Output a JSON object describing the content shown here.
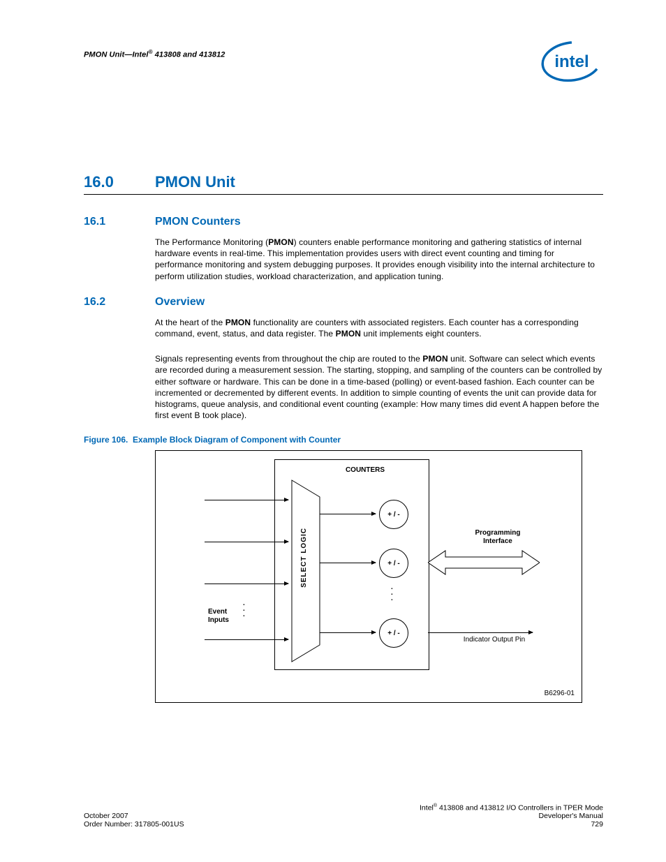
{
  "header": {
    "running_head_prefix": "PMON Unit—Intel",
    "running_head_suffix": " 413808 and 413812",
    "logo_name": "intel"
  },
  "sections": {
    "s160": {
      "num": "16.0",
      "title": "PMON Unit"
    },
    "s161": {
      "num": "16.1",
      "title": "PMON Counters"
    },
    "s162": {
      "num": "16.2",
      "title": "Overview"
    }
  },
  "paragraphs": {
    "p161": {
      "lead": "The Performance Monitoring (",
      "b1": "PMON",
      "rest": ") counters enable performance monitoring and gathering statistics of internal hardware events in real-time. This implementation provides users with direct event counting and timing for performance monitoring and system debugging purposes. It provides enough visibility into the internal architecture to perform utilization studies, workload characterization, and application tuning."
    },
    "p162a": {
      "t1": "At the heart of the ",
      "b1": "PMON",
      "t2": " functionality are counters with associated registers. Each counter has a corresponding command, event, status, and data register. The ",
      "b2": "PMON",
      "t3": " unit implements eight counters."
    },
    "p162b": {
      "t1": "Signals representing events from throughout the chip are routed to the ",
      "b1": "PMON",
      "t2": " unit. Software can select which events are recorded during a measurement session. The starting, stopping, and sampling of the counters can be controlled by either software or hardware. This can be done in a time-based (polling) or event-based fashion. Each counter can be incremented or decremented by different events. In addition to simple counting of events the unit can provide data for histograms, queue analysis, and conditional event counting (example: How many times did event A happen before the first event B took place)."
    }
  },
  "figure": {
    "caption_prefix": "Figure 106.",
    "caption_title": "Example Block Diagram of Component with Counter",
    "labels": {
      "counters": "COUNTERS",
      "select_logic": "SELECT LOGIC",
      "event_inputs_l1": "Event",
      "event_inputs_l2": "Inputs",
      "prog_iface_l1": "Programming",
      "prog_iface_l2": "Interface",
      "indicator": "Indicator Output Pin",
      "counter_sym": "+ / -",
      "diagram_id": "B6296-01"
    }
  },
  "footer": {
    "left_line1": "October 2007",
    "left_line2": "Order Number: 317805-001US",
    "right_line1_prefix": "Intel",
    "right_line1_suffix": " 413808 and 413812 I/O Controllers in TPER Mode",
    "right_line2": "Developer's Manual",
    "page_num": "729"
  }
}
